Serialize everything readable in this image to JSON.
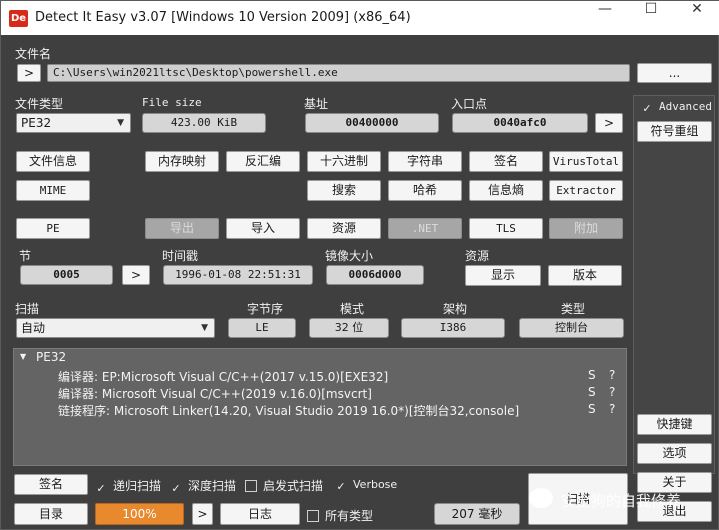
{
  "window": {
    "title": "Detect It Easy v3.07 [Windows 10 Version 2009] (x86_64)",
    "icon_text": "De",
    "controls": {
      "minimize": "—",
      "maximize": "☐",
      "close": "✕"
    }
  },
  "file": {
    "label": "文件名",
    "open_button": ">",
    "path": "C:\\Users\\win2021ltsc\\Desktop\\powershell.exe",
    "browse_button": "..."
  },
  "header": {
    "file_type_label": "文件类型",
    "file_type_value": "PE32",
    "file_size_label": "File size",
    "file_size_value": "423.00 KiB",
    "base_label": "基址",
    "base_value": "00400000",
    "entry_label": "入口点",
    "entry_value": "0040afc0",
    "entry_button": ">"
  },
  "right_panel": {
    "advanced_label": "Advanced",
    "advanced_checked": true,
    "symbol_button": "符号重组",
    "shortcut_button": "快捷键",
    "options_button": "选项",
    "about_button": "关于",
    "exit_button": "退出"
  },
  "tools_row1": [
    "文件信息",
    "内存映射",
    "反汇编",
    "十六进制",
    "字符串",
    "签名",
    "VirusTotal"
  ],
  "tools_row2": [
    "MIME",
    "搜索",
    "哈希",
    "信息熵",
    "Extractor"
  ],
  "pe_row": {
    "pe": "PE",
    "export": "导出",
    "import": "导入",
    "resources": "资源",
    "net": ".NET",
    "tls": "TLS",
    "overlay": "附加"
  },
  "sections": {
    "label": "节",
    "value": "0005",
    "button": ">",
    "time_label": "时间戳",
    "time_value": "1996-01-08 22:51:31",
    "image_size_label": "镜像大小",
    "image_size_value": "0006d000",
    "resources_label": "资源",
    "show_button": "显示",
    "version_button": "版本"
  },
  "scan": {
    "label": "扫描",
    "value": "自动",
    "endian_label": "字节序",
    "endian_value": "LE",
    "mode_label": "模式",
    "mode_value": "32 位",
    "arch_label": "架构",
    "arch_value": "I386",
    "type_label": "类型",
    "type_value": "控制台"
  },
  "results": {
    "root": "PE32",
    "rows": [
      {
        "text": "编译器: EP:Microsoft Visual C/C++(2017 v.15.0)[EXE32]",
        "s": "S",
        "q": "?"
      },
      {
        "text": "编译器: Microsoft Visual C/C++(2019 v.16.0)[msvcrt]",
        "s": "S",
        "q": "?"
      },
      {
        "text": "链接程序: Microsoft Linker(14.20, Visual Studio 2019 16.0*)[控制台32,console]",
        "s": "S",
        "q": "?"
      }
    ]
  },
  "bottom": {
    "signature_button": "签名",
    "recursive_label": "递归扫描",
    "recursive_checked": true,
    "deep_label": "深度扫描",
    "deep_checked": true,
    "heuristic_label": "启发式扫描",
    "heuristic_checked": false,
    "verbose_label": "Verbose",
    "verbose_checked": true,
    "directory_button": "目录",
    "progress_text": "100%",
    "progress_value": 100,
    "next_button": ">",
    "log_button": "日志",
    "all_types_label": "所有类型",
    "all_types_checked": false,
    "time_value": "207 毫秒",
    "scan_button": "扫描"
  },
  "watermark": {
    "text": "安全狗的自我修养"
  }
}
